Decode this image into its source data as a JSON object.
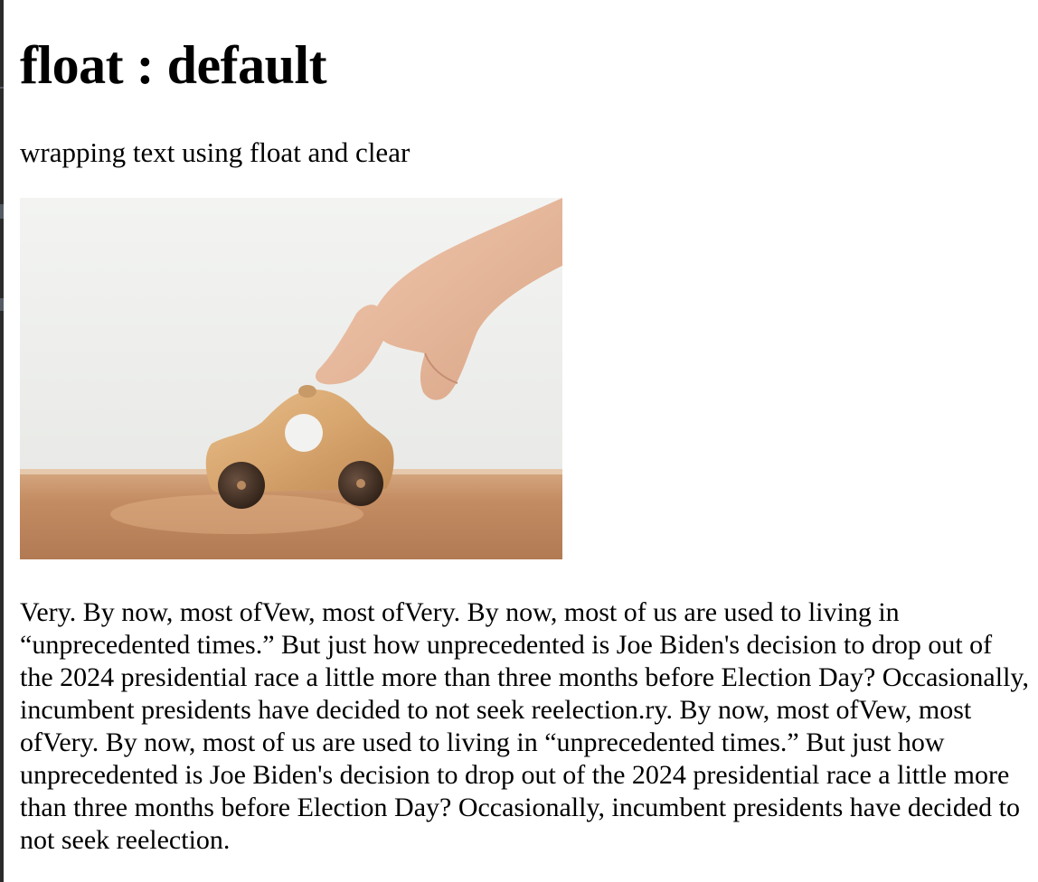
{
  "heading": "float : default",
  "subtitle": "wrapping text using float and clear",
  "image": {
    "alt": "hand pushing a wooden toy car"
  },
  "paragraph": "Very. By now, most ofVew, most ofVery. By now, most of us are used to living in “unprecedented times.” But just how unprecedented is Joe Biden's decision to drop out of the 2024 presidential race a little more than three months before Election Day? Occasionally, incumbent presidents have decided to not seek reelection.ry. By now, most ofVew, most ofVery. By now, most of us are used to living in “unprecedented times.” But just how unprecedented is Joe Biden's decision to drop out of the 2024 presidential race a little more than three months before Election Day? Occasionally, incumbent presidents have decided to not seek reelection.",
  "colors": {
    "background": "#ffffff",
    "text": "#000000",
    "editor_edge": "#2b2b2b"
  }
}
